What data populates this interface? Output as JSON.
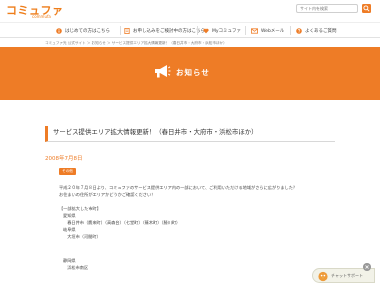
{
  "brand": {
    "logo_text": "コミュファ",
    "logo_sub": "commufa",
    "accent": "#ee7c26"
  },
  "search": {
    "placeholder": "サイト内を検索"
  },
  "nav": {
    "items": [
      {
        "label": "はじめての方はこちら"
      },
      {
        "label": "お申し込みをご検討中の方はこちら"
      },
      {
        "label": "Myコミュファ"
      },
      {
        "label": "Webメール"
      },
      {
        "label": "よくあるご質問"
      }
    ]
  },
  "breadcrumb": "コミュファ光 公式サイト ＞ お知らせ ＞ サービス提供エリア拡大情報更新！（春日井市・大府市・浜松市ほか）",
  "banner": {
    "title": "お知らせ"
  },
  "article": {
    "title": "サービス提供エリア拡大情報更新！（春日井市・大府市・浜松市ほか）",
    "date": "2008年7月8日",
    "category": "その他",
    "lines": [
      "平成２０年７月８日より、コミュファのサービス提供エリア内の一部において、ご利用いただける地域がさらに広がりました？",
      "お住まいの住所がエリアかどうかご確認ください！",
      "",
      "【一部拡大した市町】",
      "愛知県",
      "　春日井市（鷹来町）（高森台）（七堂町）（篠木町）（勝川町）",
      "岐阜県",
      "　大垣市（河間町）",
      "",
      "",
      "静岡県",
      "　浜松市南区"
    ]
  },
  "support": {
    "label": "チャットサポート"
  }
}
